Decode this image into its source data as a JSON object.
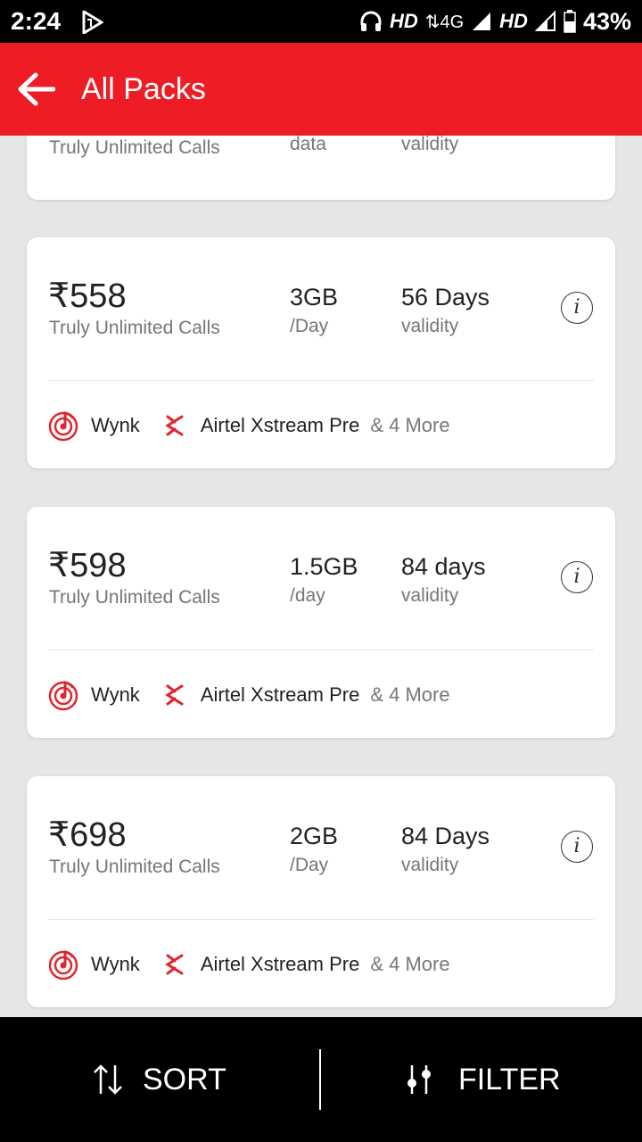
{
  "status": {
    "time": "2:24",
    "hd1": "HD",
    "network": "4G",
    "hd2": "HD",
    "battery": "43%"
  },
  "header": {
    "title": "All Packs"
  },
  "partial_card": {
    "calls": "Truly Unlimited Calls",
    "data_sub": "data",
    "validity_sub": "validity"
  },
  "packs": [
    {
      "price": "₹558",
      "calls": "Truly Unlimited Calls",
      "data": "3GB",
      "data_sub": "/Day",
      "validity": "56 Days",
      "validity_sub": "validity",
      "benefit1": "Wynk",
      "benefit2": "Airtel Xstream Pre",
      "more": "& 4 More"
    },
    {
      "price": "₹598",
      "calls": "Truly Unlimited Calls",
      "data": "1.5GB",
      "data_sub": "/day",
      "validity": "84 days",
      "validity_sub": "validity",
      "benefit1": "Wynk",
      "benefit2": "Airtel Xstream Pre",
      "more": "& 4 More"
    },
    {
      "price": "₹698",
      "calls": "Truly Unlimited Calls",
      "data": "2GB",
      "data_sub": "/Day",
      "validity": "84 Days",
      "validity_sub": "validity",
      "benefit1": "Wynk",
      "benefit2": "Airtel Xstream Pre",
      "more": "& 4 More"
    }
  ],
  "info_glyph": "i",
  "bottom": {
    "sort": "SORT",
    "filter": "FILTER"
  },
  "colors": {
    "brand": "#ee1c25",
    "accent_icon": "#e0252e"
  }
}
